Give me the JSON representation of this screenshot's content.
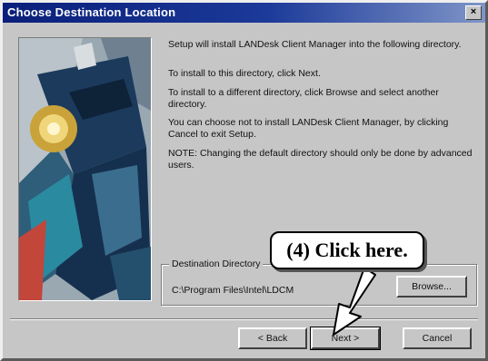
{
  "window": {
    "title": "Choose Destination Location",
    "close_glyph": "×"
  },
  "body": {
    "para1": "Setup will install LANDesk Client Manager into the following directory.",
    "para2": "To install to this directory, click Next.",
    "para3": "To install to a different directory, click Browse and select another directory.",
    "para4": "You can choose not to install LANDesk Client Manager, by clicking Cancel to exit Setup.",
    "para5": "NOTE:  Changing the default directory should only be done by advanced users."
  },
  "destination": {
    "legend": "Destination Directory",
    "path": "C:\\Program Files\\Intel\\LDCM",
    "browse_label": "Browse..."
  },
  "buttons": {
    "back_label": "< Back",
    "next_label": "Next >",
    "cancel_label": "Cancel"
  },
  "annotation": {
    "callout_text": "(4)  Click here."
  },
  "icons": [
    "close-icon",
    "installer-artwork",
    "pointer-arrow-icon"
  ],
  "colors": {
    "titlebar": "#0a1f7a",
    "dialog_bg": "#c6c6c6",
    "callout_bg": "#ffffff"
  }
}
